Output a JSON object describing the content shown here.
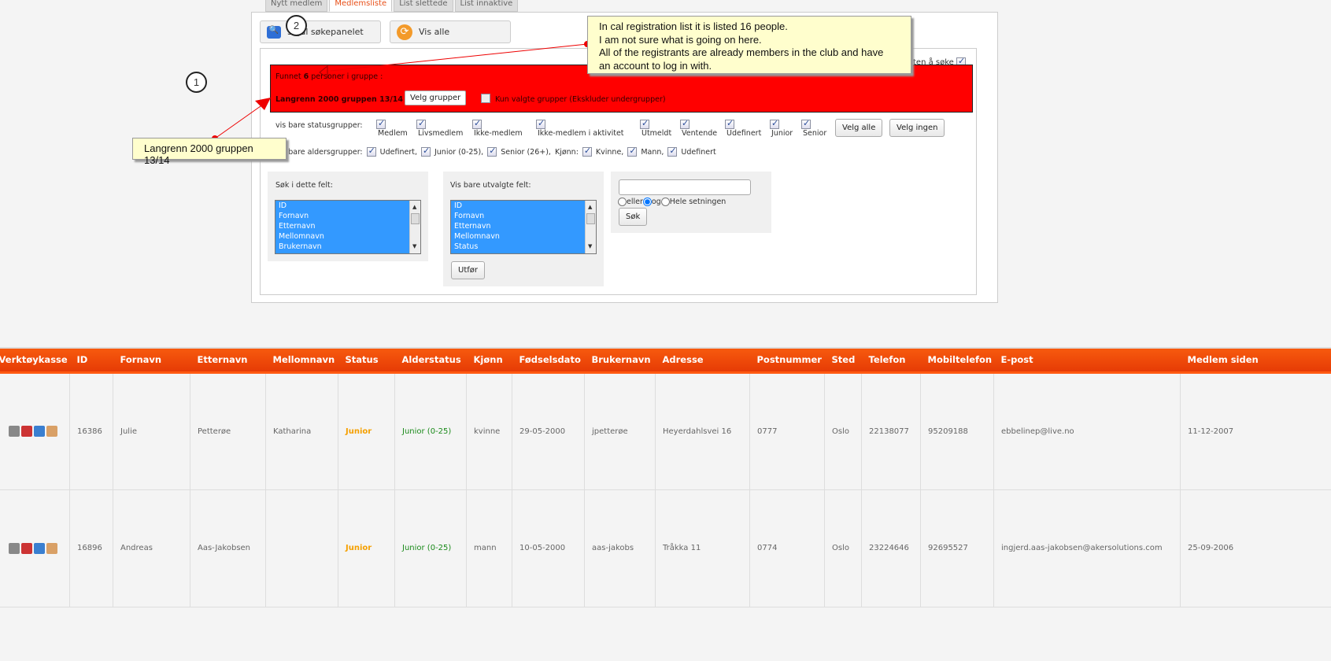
{
  "tabs": [
    "Nytt medlem",
    "Medlemsliste",
    "List slettede",
    "List innaktive"
  ],
  "toolbar": {
    "search_panel": "Skjul søkepanelet",
    "show_all": "Vis alle"
  },
  "search_hint": "ten å søke",
  "group": {
    "found_prefix": "Funnet ",
    "found_count": "6",
    "found_suffix": " personer i gruppe :",
    "group_name": "Langrenn 2000 gruppen 13/14",
    "choose_groups": "Velg grupper",
    "only_selected": "Kun valgte grupper (Ekskluder undergrupper)"
  },
  "status_filter": {
    "label": "vis bare statusgrupper:",
    "items": [
      "Medlem",
      "Livsmedlem",
      "Ikke-medlem",
      "Ikke-medlem i aktivitet",
      "Utmeldt",
      "Ventende",
      "Udefinert",
      "Junior",
      "Senior"
    ],
    "select_all": "Velg alle",
    "select_none": "Velg ingen"
  },
  "age_filter": {
    "label": "vis bare aldersgrupper:",
    "items": [
      "Udefinert,",
      "Junior (0-25),",
      "Senior (26+),"
    ],
    "gender_label": "Kjønn:",
    "genders": [
      "Kvinne,",
      "Mann,",
      "Udefinert"
    ]
  },
  "search_fields": {
    "label": "Søk i dette felt:",
    "options": [
      "ID",
      "Fornavn",
      "Etternavn",
      "Mellomnavn",
      "Brukernavn"
    ]
  },
  "show_fields": {
    "label": "Vis bare utvalgte felt:",
    "options": [
      "ID",
      "Fornavn",
      "Etternavn",
      "Mellomnavn",
      "Status"
    ],
    "apply": "Utfør"
  },
  "search": {
    "value": "",
    "modes": [
      "eller",
      "og",
      "Hele setningen"
    ],
    "selected_mode": "og",
    "button": "Søk"
  },
  "annotations": {
    "callout1": "Langrenn 2000 gruppen 13/14",
    "callout2": [
      "In cal registration list it is listed 16 people.",
      "I am not sure what is going on here.",
      "All of the registrants are already members in the club and have",
      "an account to log in with."
    ],
    "marker1": "1",
    "marker2": "2"
  },
  "table": {
    "columns": [
      "Verktøykasse",
      "ID",
      "Fornavn",
      "Etternavn",
      "Mellomnavn",
      "Status",
      "Alderstatus",
      "Kjønn",
      "Fødselsdato",
      "Brukernavn",
      "Adresse",
      "Postnummer",
      "Sted",
      "Telefon",
      "Mobiltelefon",
      "E-post",
      "Medlem siden"
    ],
    "rows": [
      [
        "",
        "16386",
        "Julie",
        "Petterøe",
        "Katharina",
        "Junior",
        "Junior (0-25)",
        "kvinne",
        "29-05-2000",
        "jpetterøe",
        "Heyerdahlsvei 16",
        "0777",
        "Oslo",
        "22138077",
        "95209188",
        "ebbelinep@live.no",
        "11-12-2007"
      ],
      [
        "",
        "16896",
        "Andreas",
        "Aas-Jakobsen",
        "",
        "Junior",
        "Junior (0-25)",
        "mann",
        "10-05-2000",
        "aas-jakobs",
        "Tråkka 11",
        "0774",
        "Oslo",
        "23224646",
        "92695527",
        "ingjerd.aas-jakobsen@akersolutions.com",
        "25-09-2006"
      ]
    ]
  },
  "colors": {
    "accent": "#f0500a",
    "alert": "#ff0000",
    "callout": "#fffecd",
    "selection": "#3399ff"
  }
}
